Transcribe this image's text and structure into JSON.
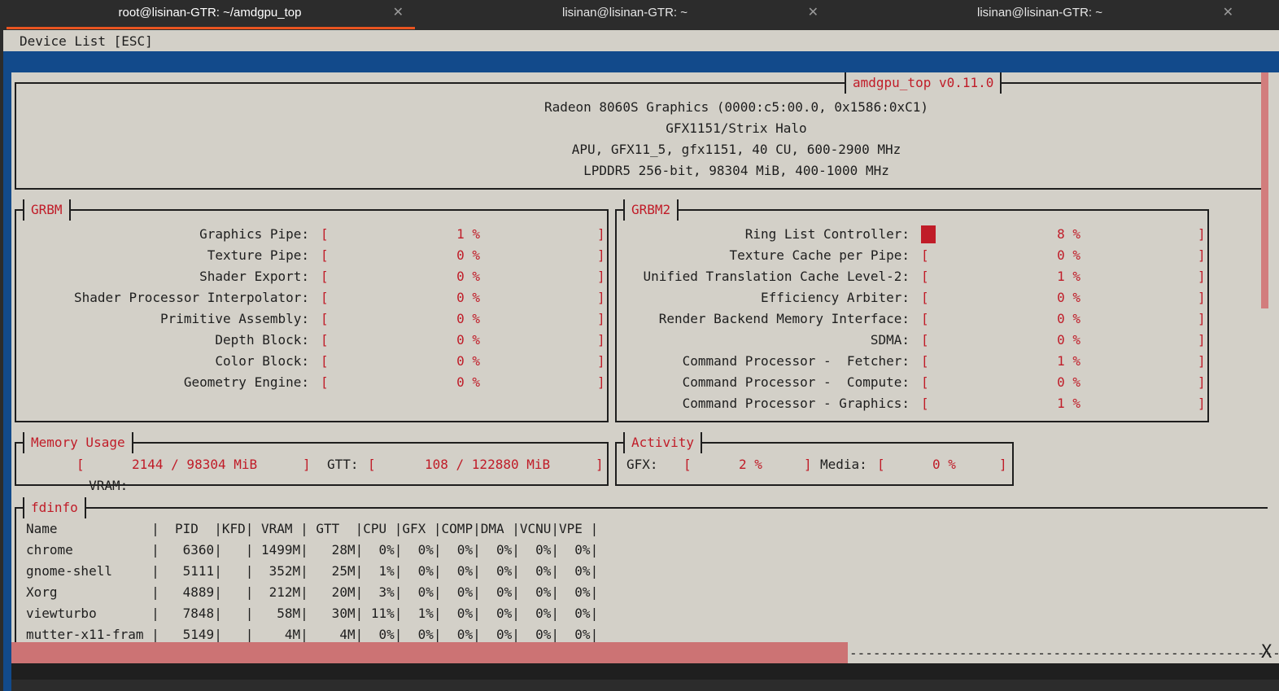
{
  "tabs": [
    {
      "title": "root@lisinan-GTR: ~/amdgpu_top",
      "active": true
    },
    {
      "title": "lisinan@lisinan-GTR: ~",
      "active": false
    },
    {
      "title": "lisinan@lisinan-GTR: ~",
      "active": false
    }
  ],
  "menu": {
    "device_list": "Device List [ESC]"
  },
  "header": {
    "title": "amdgpu_top v0.11.0",
    "line1": "Radeon 8060S Graphics (0000:c5:00.0, 0x1586:0xC1)",
    "line2": "GFX1151/Strix Halo",
    "line3": "APU, GFX11_5, gfx1151, 40 CU, 600-2900 MHz",
    "line4": "LPDDR5 256-bit, 98304 MiB, 400-1000 MHz"
  },
  "grbm": {
    "title": "GRBM",
    "items": [
      {
        "label": "Graphics Pipe:",
        "value": "1 %"
      },
      {
        "label": "Texture Pipe:",
        "value": "0 %"
      },
      {
        "label": "Shader Export:",
        "value": "0 %"
      },
      {
        "label": "Shader Processor Interpolator:",
        "value": "0 %"
      },
      {
        "label": "Primitive Assembly:",
        "value": "0 %"
      },
      {
        "label": "Depth Block:",
        "value": "0 %"
      },
      {
        "label": "Color Block:",
        "value": "0 %"
      },
      {
        "label": "Geometry Engine:",
        "value": "0 %"
      }
    ]
  },
  "grbm2": {
    "title": "GRBM2",
    "items": [
      {
        "label": "Ring List Controller:",
        "value": "8 %"
      },
      {
        "label": "Texture Cache per Pipe:",
        "value": "0 %"
      },
      {
        "label": "Unified Translation Cache Level-2:",
        "value": "1 %"
      },
      {
        "label": "Efficiency Arbiter:",
        "value": "0 %"
      },
      {
        "label": "Render Backend Memory Interface:",
        "value": "0 %"
      },
      {
        "label": "SDMA:",
        "value": "0 %"
      },
      {
        "label": "Command Processor -  Fetcher:",
        "value": "1 %"
      },
      {
        "label": "Command Processor -  Compute:",
        "value": "0 %"
      },
      {
        "label": "Command Processor - Graphics:",
        "value": "1 %"
      }
    ]
  },
  "memory": {
    "title": "Memory Usage",
    "vram_label": "VRAM:",
    "vram_value": "2144 / 98304 MiB",
    "gtt_label": "GTT:",
    "gtt_value": "108 / 122880 MiB"
  },
  "activity": {
    "title": "Activity",
    "gfx_label": "GFX:",
    "gfx_value": "2 %",
    "media_label": "Media:",
    "media_value": "0 %"
  },
  "fdinfo": {
    "title": "fdinfo",
    "header": "Name            |  PID  |KFD| VRAM | GTT  |CPU |GFX |COMP|DMA |VCNU|VPE |",
    "rows": [
      "chrome          |   6360|   | 1499M|   28M|  0%|  0%|  0%|  0%|  0%|  0%|",
      "gnome-shell     |   5111|   |  352M|   25M|  1%|  0%|  0%|  0%|  0%|  0%|",
      "Xorg            |   4889|   |  212M|   20M|  3%|  0%|  0%|  0%|  0%|  0%|",
      "viewturbo       |   7848|   |   58M|   30M| 11%|  1%|  0%|  0%|  0%|  0%|",
      "mutter-x11-fram |   5149|   |    4M|    4M|  0%|  0%|  0%|  0%|  0%|  0%|"
    ]
  },
  "statusbar": {
    "progress": 0.66,
    "tail": "X"
  },
  "colors": {
    "accent": "#c01c28",
    "terminal_bg": "#d3d0c8",
    "blue": "#124a8b",
    "progress": "#cc7374",
    "tab_active": "#e95420"
  }
}
